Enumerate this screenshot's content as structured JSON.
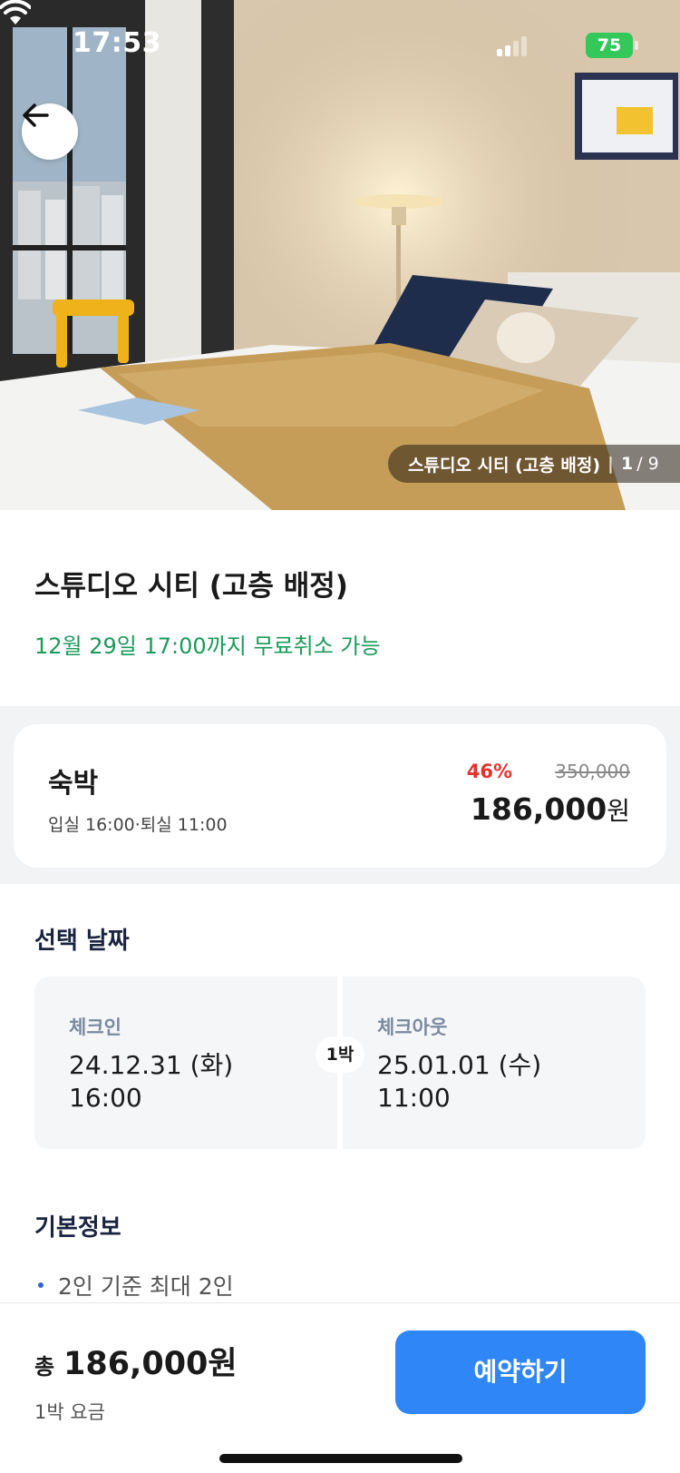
{
  "status_bar": {
    "time": "17:53",
    "battery": "75"
  },
  "gallery": {
    "caption": "스튜디오 시티 (고층 배정)",
    "current": "1",
    "total": "/ 9"
  },
  "room": {
    "title": "스튜디오 시티 (고층 배정)",
    "cancel_note": "12월 29일 17:00까지 무료취소 가능"
  },
  "price_card": {
    "stay_type": "숙박",
    "times": "입실 16:00·퇴실 11:00",
    "discount": "46%",
    "original_price": "350,000",
    "final_price": "186,000",
    "currency": "원"
  },
  "dates": {
    "title": "선택 날짜",
    "checkin_label": "체크인",
    "checkin_date": "24.12.31 (화)",
    "checkin_time": "16:00",
    "nights": "1박",
    "checkout_label": "체크아웃",
    "checkout_date": "25.01.01 (수)",
    "checkout_time": "11:00"
  },
  "basic_info": {
    "title": "기본정보",
    "items": [
      "2인 기준 최대 2인"
    ]
  },
  "bottom_bar": {
    "total_label": "총",
    "total_amount": "186,000원",
    "per_night": "1박 요금",
    "book_label": "예약하기"
  },
  "colors": {
    "accent": "#2f86f6",
    "discount": "#e5322d",
    "free_cancel": "#1a9a5a",
    "battery": "#34c759"
  }
}
